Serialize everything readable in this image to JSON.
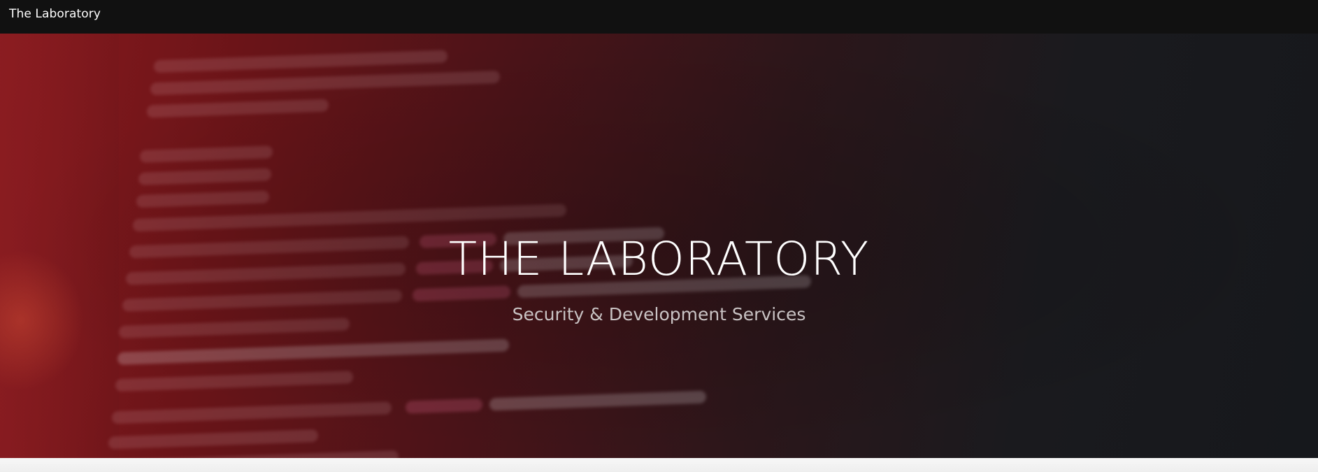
{
  "navbar": {
    "brand": "The Laboratory"
  },
  "hero": {
    "title": "THE LABORATORY",
    "subtitle": "Security & Development Services"
  },
  "colors": {
    "navbar_bg": "#111111",
    "hero_red": "#8a1a1e",
    "hero_dark": "#16181c",
    "title_text": "#ffffff",
    "subtitle_text": "#c9c3c4"
  }
}
